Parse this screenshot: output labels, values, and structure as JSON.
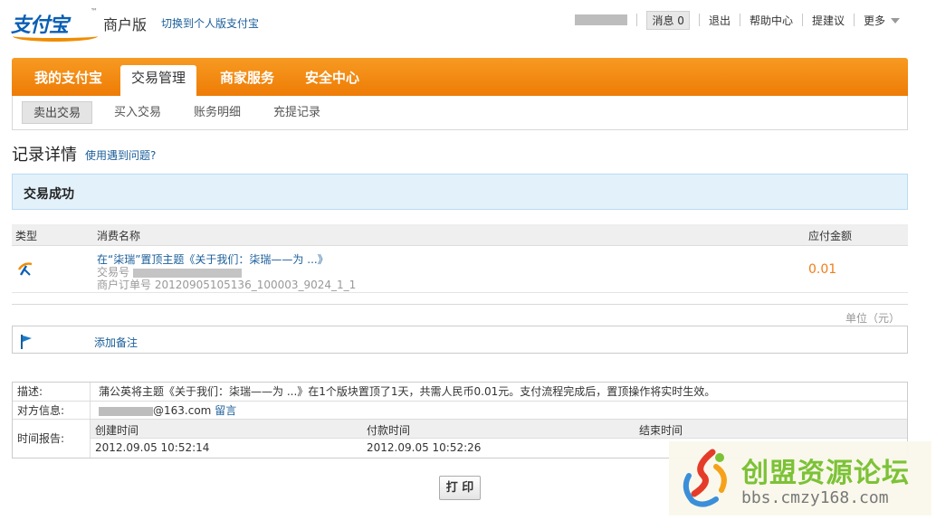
{
  "header": {
    "brand_mark": "支付宝",
    "edition": "商户版",
    "switch_link": "切换到个人版支付宝",
    "message_label": "消息",
    "message_count": "0",
    "logout": "退出",
    "help_center": "帮助中心",
    "feedback": "提建议",
    "more": "更多"
  },
  "mainnav": {
    "tabs": [
      {
        "label": "我的支付宝",
        "active": false
      },
      {
        "label": "交易管理",
        "active": true
      },
      {
        "label": "商家服务",
        "active": false
      },
      {
        "label": "安全中心",
        "active": false
      }
    ]
  },
  "subnav": {
    "items": [
      {
        "label": "卖出交易",
        "active": true
      },
      {
        "label": "买入交易",
        "active": false
      },
      {
        "label": "账务明细",
        "active": false
      },
      {
        "label": "充提记录",
        "active": false
      }
    ]
  },
  "page": {
    "title": "记录详情",
    "help_link": "使用遇到问题?",
    "status": "交易成功"
  },
  "detail": {
    "col_type": "类型",
    "col_name": "消费名称",
    "col_amount": "应付金额",
    "item_name": "在“柒瑞”置顶主题《关于我们：柒瑞——为 ...》",
    "trade_no_label": "交易号",
    "order_no": "商户订单号 20120905105136_100003_9024_1_1",
    "amount": "0.01",
    "unit": "单位（元）"
  },
  "remark": {
    "add_label": "添加备注"
  },
  "info": {
    "desc_label": "描述:",
    "desc_value": "蒲公英将主题《关于我们：柒瑞——为 ...》在1个版块置顶了1天，共需人民币0.01元。支付流程完成后，置顶操作将实时生效。",
    "party_label": "对方信息:",
    "party_email": "@163.com",
    "party_msg": "留言",
    "time_label": "时间报告:",
    "created_label": "创建时间",
    "paid_label": "付款时间",
    "end_label": "结束时间",
    "created_value": "2012.09.05 10:52:14",
    "paid_value": "2012.09.05 10:52:26"
  },
  "actions": {
    "print": "打 印"
  },
  "watermark": {
    "name": "创盟资源论坛",
    "url": "bbs.cmzy168.com"
  },
  "colors": {
    "brand_orange": "#ee7c05",
    "link_blue": "#1a5e9a",
    "amount_orange": "#f07d1a",
    "banner_bg": "#e3f1fb"
  }
}
